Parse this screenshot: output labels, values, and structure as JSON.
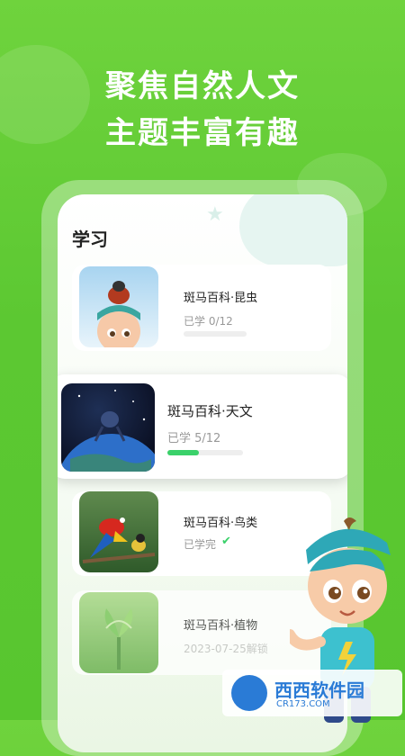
{
  "headline": {
    "line1": "聚焦自然人文",
    "line2": "主题丰富有趣"
  },
  "section": {
    "title": "学习"
  },
  "courses": [
    {
      "title": "斑马百科·昆虫",
      "status": "已学 0/12",
      "progress": 0
    },
    {
      "title": "斑马百科·天文",
      "status": "已学 5/12",
      "progress": 0.4167
    },
    {
      "title": "斑马百科·鸟类",
      "status": "已学完",
      "completed": true
    },
    {
      "title": "斑马百科·植物",
      "status": "2023-07-25解锁"
    }
  ],
  "watermark": {
    "brand": "西西软件园",
    "url": "CR173.COM"
  },
  "colors": {
    "accent": "#3ad16a",
    "background": "#5cc832"
  }
}
